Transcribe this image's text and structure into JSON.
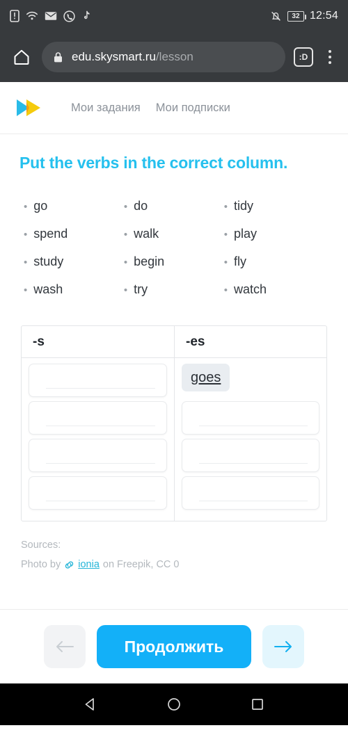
{
  "status_bar": {
    "icons": [
      "sim-card-icon",
      "wifi-icon",
      "email-icon",
      "viber-icon",
      "tiktok-icon"
    ],
    "mute_icon": "bell-muted-icon",
    "battery_level": "32",
    "time": "12:54"
  },
  "browser": {
    "home_icon": "home-icon",
    "lock_icon": "lock-icon",
    "url_domain": "edu.skysmart.ru",
    "url_path": "/lesson",
    "tab_count_label": ":D",
    "menu_icon": "overflow-menu-icon"
  },
  "site_header": {
    "logo_name": "skysmart-logo",
    "nav": [
      {
        "label": "Мои задания"
      },
      {
        "label": "Мои подписки"
      }
    ]
  },
  "task": {
    "title": "Put the verbs in the correct column.",
    "title_color": "#25c0ee",
    "verb_columns": [
      [
        "go",
        "spend",
        "study",
        "wash"
      ],
      [
        "do",
        "walk",
        "begin",
        "try"
      ],
      [
        "tidy",
        "play",
        "fly",
        "watch"
      ]
    ]
  },
  "table": {
    "columns": [
      {
        "header": "-s",
        "cells": [
          {
            "type": "empty",
            "value": ""
          },
          {
            "type": "empty",
            "value": ""
          },
          {
            "type": "empty",
            "value": ""
          },
          {
            "type": "empty",
            "value": ""
          }
        ]
      },
      {
        "header": "-es",
        "cells": [
          {
            "type": "chip",
            "value": "goes"
          },
          {
            "type": "empty",
            "value": ""
          },
          {
            "type": "empty",
            "value": ""
          },
          {
            "type": "empty",
            "value": ""
          }
        ]
      }
    ]
  },
  "sources": {
    "label": "Sources:",
    "prefix": "Photo by",
    "link_icon": "link-icon",
    "link_text": "ionia",
    "suffix": "on Freepik, CC 0"
  },
  "actions": {
    "prev_icon": "arrow-left-icon",
    "continue_label": "Продолжить",
    "next_icon": "arrow-right-icon",
    "primary_color": "#13b0f8"
  },
  "android_nav": {
    "back": "back-triangle-icon",
    "home": "home-circle-icon",
    "recents": "recents-square-icon"
  }
}
